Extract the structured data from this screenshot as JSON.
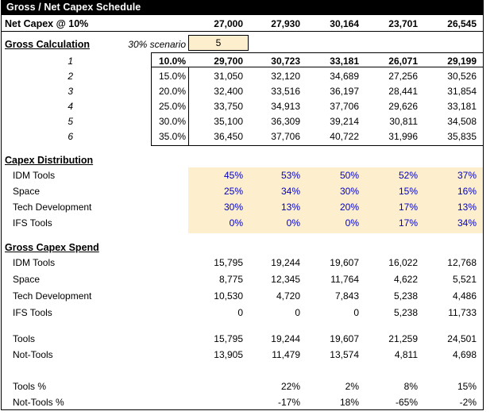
{
  "document": {
    "title": "Gross / Net Capex Schedule"
  },
  "colors": {
    "title_bar_bg": "#000000",
    "title_bar_text": "#ffffff",
    "input_cell_bg": "#fdeecd",
    "input_text": "#0000cc",
    "grid_line": "#000000"
  },
  "net_capex": {
    "label": "Net Capex @ 10%",
    "values": [
      "27,000",
      "27,930",
      "30,164",
      "23,701",
      "26,545"
    ]
  },
  "gross_calculation": {
    "heading": "Gross Calculation",
    "scenario_label": "30% scenario",
    "scenario_value": "5",
    "row_numbers": [
      "1",
      "2",
      "3",
      "4",
      "5",
      "6"
    ],
    "uplift": [
      "10.0%",
      "15.0%",
      "20.0%",
      "25.0%",
      "30.0%",
      "35.0%"
    ],
    "rows": [
      [
        "29,700",
        "30,723",
        "33,181",
        "26,071",
        "29,199"
      ],
      [
        "31,050",
        "32,120",
        "34,689",
        "27,256",
        "30,526"
      ],
      [
        "32,400",
        "33,516",
        "36,197",
        "28,441",
        "31,854"
      ],
      [
        "33,750",
        "34,913",
        "37,706",
        "29,626",
        "33,181"
      ],
      [
        "35,100",
        "36,309",
        "39,214",
        "30,811",
        "34,508"
      ],
      [
        "36,450",
        "37,706",
        "40,722",
        "31,996",
        "35,835"
      ]
    ]
  },
  "capex_distribution": {
    "heading": "Capex Distribution",
    "labels": [
      "IDM Tools",
      "Space",
      "Tech Development",
      "IFS Tools"
    ],
    "rows": [
      [
        "45%",
        "53%",
        "50%",
        "52%",
        "37%"
      ],
      [
        "25%",
        "34%",
        "30%",
        "15%",
        "16%"
      ],
      [
        "30%",
        "13%",
        "20%",
        "17%",
        "13%"
      ],
      [
        "0%",
        "0%",
        "0%",
        "17%",
        "34%"
      ]
    ]
  },
  "gross_capex_spend": {
    "heading": "Gross Capex Spend",
    "labels": [
      "IDM Tools",
      "Space",
      "Tech Development",
      "IFS Tools"
    ],
    "rows": [
      [
        "15,795",
        "19,244",
        "19,607",
        "16,022",
        "12,768"
      ],
      [
        "8,775",
        "12,345",
        "11,764",
        "4,622",
        "5,521"
      ],
      [
        "10,530",
        "4,720",
        "7,843",
        "5,238",
        "4,486"
      ],
      [
        "0",
        "0",
        "0",
        "5,238",
        "11,733"
      ]
    ]
  },
  "totals": {
    "labels": [
      "Tools",
      "Not-Tools"
    ],
    "rows": [
      [
        "15,795",
        "19,244",
        "19,607",
        "21,259",
        "24,501"
      ],
      [
        "13,905",
        "11,479",
        "13,574",
        "4,811",
        "4,698"
      ]
    ]
  },
  "growth": {
    "labels": [
      "Tools %",
      "Not-Tools %"
    ],
    "rows": [
      [
        "",
        "22%",
        "2%",
        "8%",
        "15%"
      ],
      [
        "",
        "-17%",
        "18%",
        "-65%",
        "-2%"
      ]
    ]
  }
}
